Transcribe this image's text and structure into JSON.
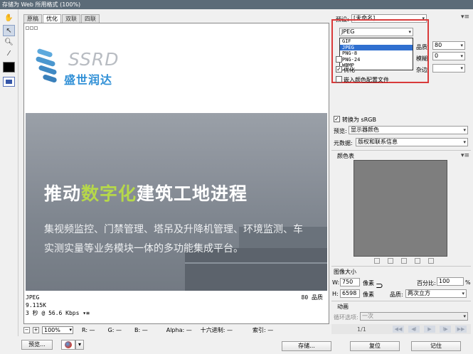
{
  "window": {
    "title": "存储为 Web 所用格式 (100%)"
  },
  "tabs": [
    "原稿",
    "优化",
    "双联",
    "四联"
  ],
  "preview_image": {
    "logo_en": "SSRD",
    "logo_cn": "盛世润达",
    "headline_a": "推动",
    "headline_b": "数字化",
    "headline_c": "建筑工地进程",
    "subline1": "集视频监控、门禁管理、塔吊及升降机管理、环境监测、车",
    "subline2": "实测实量等业务模块一体的多功能集成平台。"
  },
  "preview_info": {
    "format": "JPEG",
    "size": "9.115K",
    "speed": "3 秒 @ 56.6 Kbps",
    "quality": "80 品质"
  },
  "status": {
    "zoom": "100%",
    "r": "R: —",
    "g": "G: —",
    "b": "B: —",
    "alpha": "Alpha: —",
    "hex": "十六进制: —",
    "index": "索引: —"
  },
  "buttons": {
    "preview": "预览...",
    "save": "存储...",
    "reset": "复位",
    "remember": "记住"
  },
  "settings": {
    "preset_label": "预设:",
    "preset_value": "[未命名]",
    "format_value": "JPEG",
    "format_options": [
      "GIF",
      "JPEG",
      "PNG-8",
      "PNG-24",
      "WBMP"
    ],
    "format_selected_index": 1,
    "quality_label": "品质",
    "quality_value": "80",
    "blur_label": "模糊",
    "blur_value": "0",
    "matte_label": "杂边",
    "optimized_label": "优化",
    "embed_profile_label": "嵌入颜色配置文件",
    "convert_srgb_label": "转换为 sRGB",
    "preview_label": "预览:",
    "preview_value": "显示器颜色",
    "metadata_label": "元数据:",
    "metadata_value": "版权和联系信息",
    "color_table_label": "颜色表"
  },
  "image_size": {
    "header": "图像大小",
    "w_label": "W:",
    "w_value": "750",
    "h_label": "H:",
    "h_value": "6598",
    "unit": "像素",
    "percent_label": "百分比:",
    "percent_value": "100",
    "percent_unit": "%",
    "quality_label": "品质:",
    "quality_value": "两次立方"
  },
  "animation": {
    "header": "动画",
    "loop_label": "循环选项:",
    "loop_value": "一次",
    "frame": "1/1"
  },
  "colors": {
    "accent_red": "#d93a3a",
    "selection_blue": "#3070d0",
    "logo_blue": "#2f8fd6",
    "headline_green": "#b6d84a"
  }
}
